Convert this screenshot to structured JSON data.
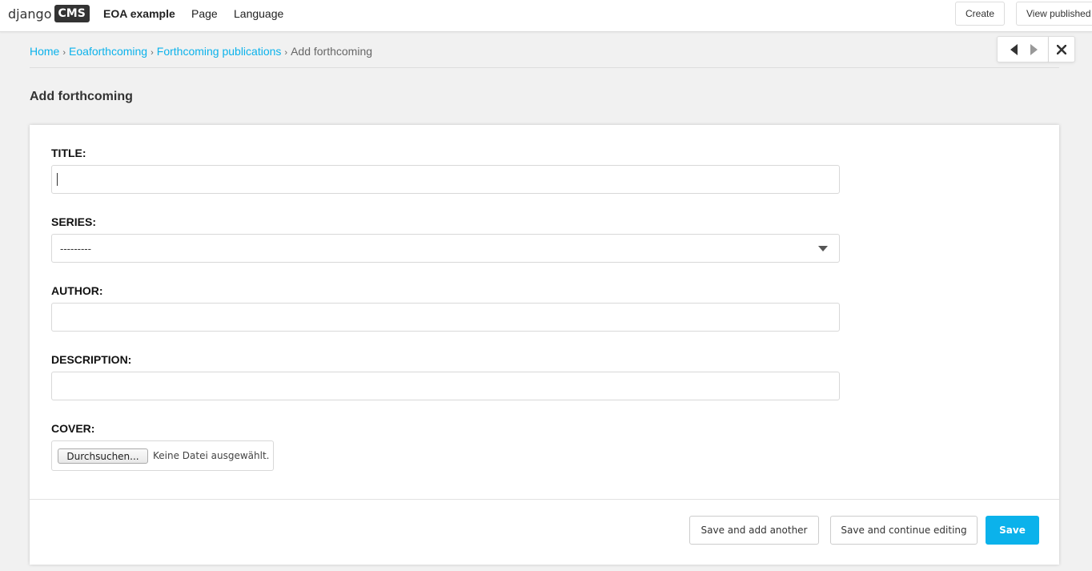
{
  "toolbar": {
    "logo_text": "django",
    "logo_badge": "CMS",
    "site_menu": "EOA example",
    "page_menu": "Page",
    "language_menu": "Language",
    "create_button": "Create",
    "view_published_button": "View published"
  },
  "breadcrumb": {
    "items": [
      "Home",
      "Eoaforthcoming",
      "Forthcoming publications"
    ],
    "current": "Add forthcoming",
    "separator": "›"
  },
  "page_title": "Add forthcoming",
  "form": {
    "title_label": "TITLE:",
    "title_value": "",
    "series_label": "SERIES:",
    "series_selected": "---------",
    "author_label": "AUTHOR:",
    "author_value": "",
    "description_label": "DESCRIPTION:",
    "description_value": "",
    "cover_label": "COVER:",
    "cover_button": "Durchsuchen...",
    "cover_status": "Keine Datei ausgewählt."
  },
  "actions": {
    "save_add_another": "Save and add another",
    "save_continue": "Save and continue editing",
    "save": "Save"
  },
  "colors": {
    "accent": "#0bb2eb",
    "background": "#f1f1f1"
  },
  "icons": {
    "prev": "caret-left-icon",
    "next": "caret-right-icon",
    "close": "close-icon",
    "select": "chevron-down-icon"
  }
}
